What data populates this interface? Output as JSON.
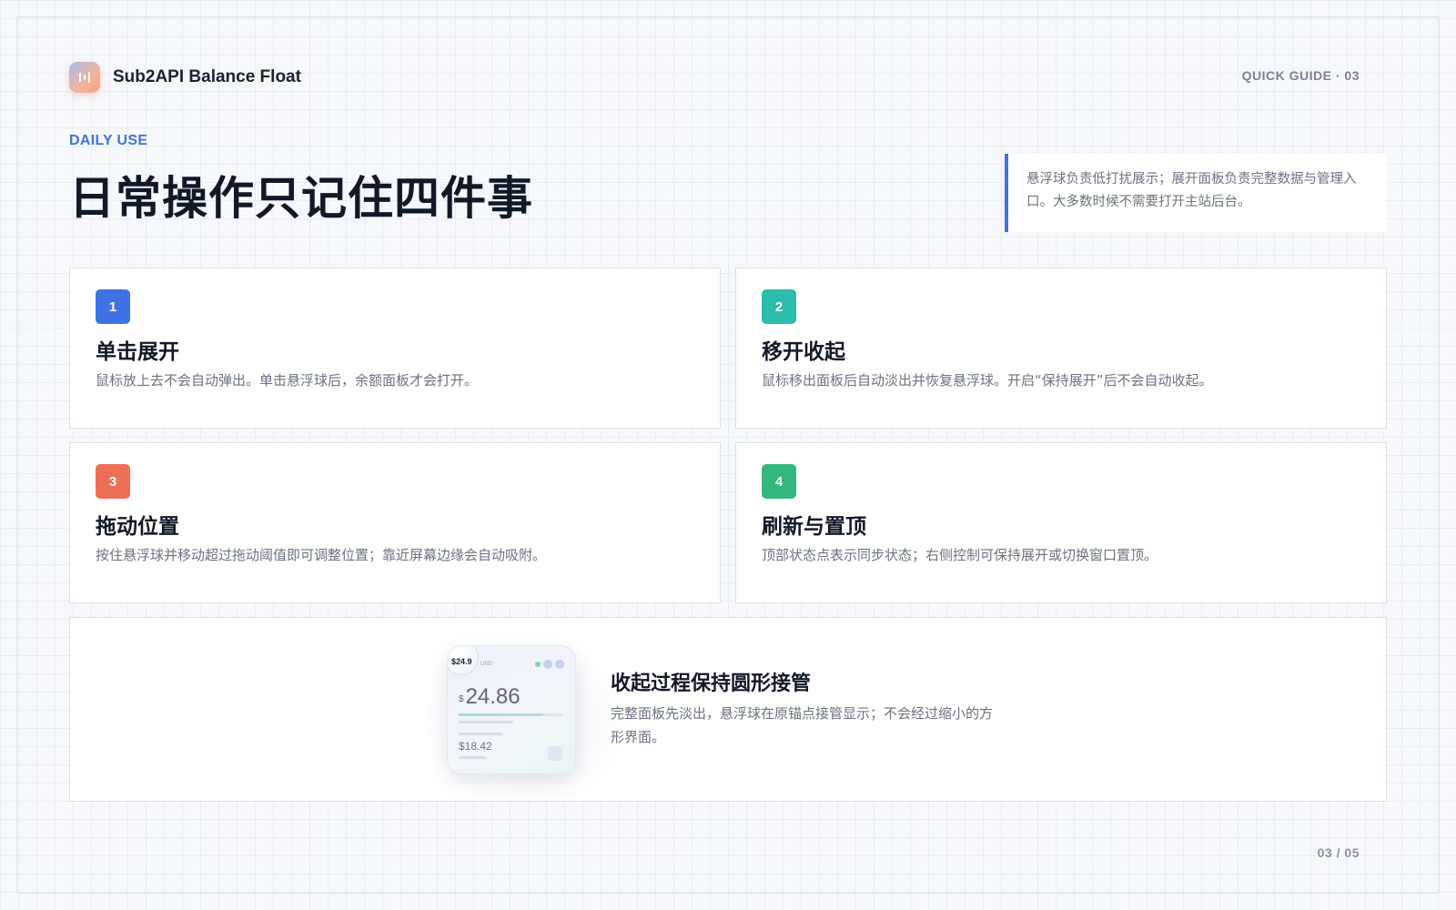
{
  "brand": {
    "name": "Sub2API Balance Float"
  },
  "header": {
    "section_tag": "QUICK GUIDE · 03"
  },
  "hero": {
    "eyebrow": "DAILY USE",
    "title": "日常操作只记住四件事",
    "note": "悬浮球负责低打扰展示；展开面板负责完整数据与管理入口。大多数时候不需要打开主站后台。"
  },
  "cards": [
    {
      "number": "1",
      "title": "单击展开",
      "desc": "鼠标放上去不会自动弹出。单击悬浮球后，余额面板才会打开。",
      "color": "#3f73e4"
    },
    {
      "number": "2",
      "title": "移开收起",
      "desc": "鼠标移出面板后自动淡出并恢复悬浮球。开启“保持展开”后不会自动收起。",
      "color": "#2bbcab"
    },
    {
      "number": "3",
      "title": "拖动位置",
      "desc": "按住悬浮球并移动超过拖动阈值即可调整位置；靠近屏幕边缘会自动吸附。",
      "color": "#ee6e55"
    },
    {
      "number": "4",
      "title": "刷新与置顶",
      "desc": "顶部状态点表示同步状态；右侧控制可保持展开或切换窗口置顶。",
      "color": "#33b77c"
    }
  ],
  "feature": {
    "title": "收起过程保持圆形接管",
    "desc": "完整面板先淡出，悬浮球在原锚点接管显示；不会经过缩小的方形界面。",
    "preview": {
      "ball_value": "$24.9",
      "currency_label": "· USD",
      "currency_symbol": "$",
      "balance": "24.86",
      "secondary": "$18.42",
      "progress": 0.82
    }
  },
  "footer": {
    "page": "03 / 05"
  }
}
